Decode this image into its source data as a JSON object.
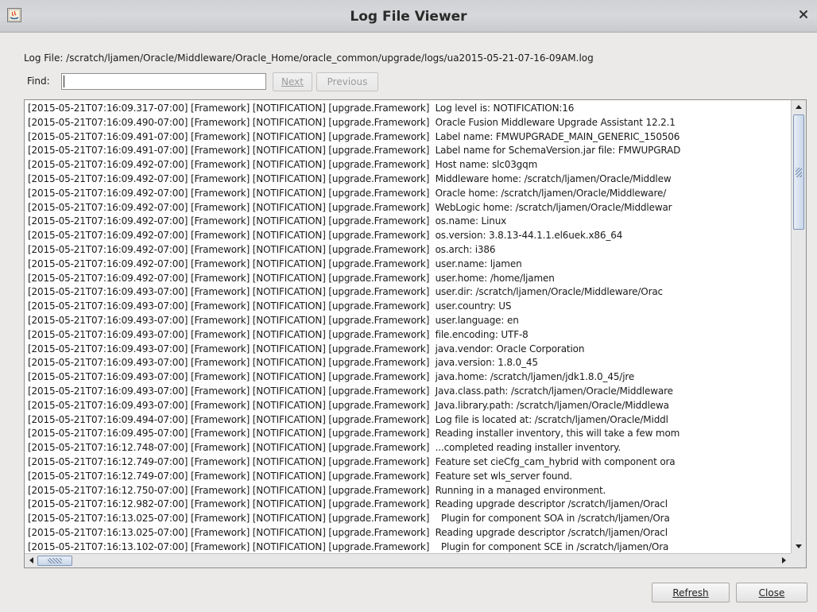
{
  "window": {
    "title": "Log File Viewer",
    "close_glyph": "×",
    "icon": "java-app-icon"
  },
  "file": {
    "label": "Log File: /scratch/ljamen/Oracle/Middleware/Oracle_Home/oracle_common/upgrade/logs/ua2015-05-21-07-16-09AM.log"
  },
  "find": {
    "label": "Find:",
    "value": "",
    "next_label": "Next",
    "previous_label": "Previous"
  },
  "log": {
    "lines": [
      "[2015-05-21T07:16:09.317-07:00] [Framework] [NOTIFICATION] [upgrade.Framework]  Log level is: NOTIFICATION:16",
      "[2015-05-21T07:16:09.490-07:00] [Framework] [NOTIFICATION] [upgrade.Framework]  Oracle Fusion Middleware Upgrade Assistant 12.2.1",
      "[2015-05-21T07:16:09.491-07:00] [Framework] [NOTIFICATION] [upgrade.Framework]  Label name: FMWUPGRADE_MAIN_GENERIC_150506",
      "[2015-05-21T07:16:09.491-07:00] [Framework] [NOTIFICATION] [upgrade.Framework]  Label name for SchemaVersion.jar file: FMWUPGRAD",
      "[2015-05-21T07:16:09.492-07:00] [Framework] [NOTIFICATION] [upgrade.Framework]  Host name: slc03gqm",
      "[2015-05-21T07:16:09.492-07:00] [Framework] [NOTIFICATION] [upgrade.Framework]  Middleware home: /scratch/ljamen/Oracle/Middlew",
      "[2015-05-21T07:16:09.492-07:00] [Framework] [NOTIFICATION] [upgrade.Framework]  Oracle home: /scratch/ljamen/Oracle/Middleware/",
      "[2015-05-21T07:16:09.492-07:00] [Framework] [NOTIFICATION] [upgrade.Framework]  WebLogic home: /scratch/ljamen/Oracle/Middlewar",
      "[2015-05-21T07:16:09.492-07:00] [Framework] [NOTIFICATION] [upgrade.Framework]  os.name: Linux",
      "[2015-05-21T07:16:09.492-07:00] [Framework] [NOTIFICATION] [upgrade.Framework]  os.version: 3.8.13-44.1.1.el6uek.x86_64",
      "[2015-05-21T07:16:09.492-07:00] [Framework] [NOTIFICATION] [upgrade.Framework]  os.arch: i386",
      "[2015-05-21T07:16:09.492-07:00] [Framework] [NOTIFICATION] [upgrade.Framework]  user.name: ljamen",
      "[2015-05-21T07:16:09.492-07:00] [Framework] [NOTIFICATION] [upgrade.Framework]  user.home: /home/ljamen",
      "[2015-05-21T07:16:09.493-07:00] [Framework] [NOTIFICATION] [upgrade.Framework]  user.dir: /scratch/ljamen/Oracle/Middleware/Orac",
      "[2015-05-21T07:16:09.493-07:00] [Framework] [NOTIFICATION] [upgrade.Framework]  user.country: US",
      "[2015-05-21T07:16:09.493-07:00] [Framework] [NOTIFICATION] [upgrade.Framework]  user.language: en",
      "[2015-05-21T07:16:09.493-07:00] [Framework] [NOTIFICATION] [upgrade.Framework]  file.encoding: UTF-8",
      "[2015-05-21T07:16:09.493-07:00] [Framework] [NOTIFICATION] [upgrade.Framework]  java.vendor: Oracle Corporation",
      "[2015-05-21T07:16:09.493-07:00] [Framework] [NOTIFICATION] [upgrade.Framework]  java.version: 1.8.0_45",
      "[2015-05-21T07:16:09.493-07:00] [Framework] [NOTIFICATION] [upgrade.Framework]  java.home: /scratch/ljamen/jdk1.8.0_45/jre",
      "[2015-05-21T07:16:09.493-07:00] [Framework] [NOTIFICATION] [upgrade.Framework]  Java.class.path: /scratch/ljamen/Oracle/Middleware",
      "[2015-05-21T07:16:09.493-07:00] [Framework] [NOTIFICATION] [upgrade.Framework]  Java.library.path: /scratch/ljamen/Oracle/Middlewa",
      "[2015-05-21T07:16:09.494-07:00] [Framework] [NOTIFICATION] [upgrade.Framework]  Log file is located at: /scratch/ljamen/Oracle/Middl",
      "[2015-05-21T07:16:09.495-07:00] [Framework] [NOTIFICATION] [upgrade.Framework]  Reading installer inventory, this will take a few mom",
      "[2015-05-21T07:16:12.748-07:00] [Framework] [NOTIFICATION] [upgrade.Framework]  ...completed reading installer inventory.",
      "[2015-05-21T07:16:12.749-07:00] [Framework] [NOTIFICATION] [upgrade.Framework]  Feature set cieCfg_cam_hybrid with component ora",
      "[2015-05-21T07:16:12.749-07:00] [Framework] [NOTIFICATION] [upgrade.Framework]  Feature set wls_server found.",
      "[2015-05-21T07:16:12.750-07:00] [Framework] [NOTIFICATION] [upgrade.Framework]  Running in a managed environment.",
      "[2015-05-21T07:16:12.982-07:00] [Framework] [NOTIFICATION] [upgrade.Framework]  Reading upgrade descriptor /scratch/ljamen/Oracl",
      "[2015-05-21T07:16:13.025-07:00] [Framework] [NOTIFICATION] [upgrade.Framework]    Plugin for component SOA in /scratch/ljamen/Ora",
      "[2015-05-21T07:16:13.025-07:00] [Framework] [NOTIFICATION] [upgrade.Framework]  Reading upgrade descriptor /scratch/ljamen/Oracl",
      "[2015-05-21T07:16:13.102-07:00] [Framework] [NOTIFICATION] [upgrade.Framework]    Plugin for component SCE in /scratch/ljamen/Ora"
    ]
  },
  "buttons": {
    "refresh_label": "Refresh",
    "close_label": "Close"
  }
}
